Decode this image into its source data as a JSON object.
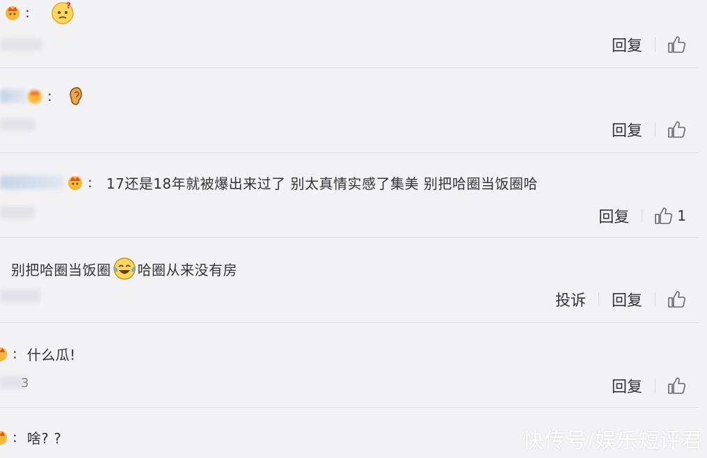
{
  "comments": [
    {
      "text": "",
      "meta": "",
      "actions": {
        "reply": "回复"
      }
    },
    {
      "text": "",
      "meta": "",
      "actions": {
        "reply": "回复"
      }
    },
    {
      "text": "17还是18年就被爆出来过了 别太真情实感了集美 别把哈圈当饭圈哈",
      "meta": "",
      "actions": {
        "reply": "回复"
      },
      "likes": "1"
    },
    {
      "text_a": "别把哈圈当饭圈",
      "text_b": "哈圈从来没有房",
      "meta": "",
      "actions": {
        "report": "投诉",
        "reply": "回复"
      }
    },
    {
      "text": "什么瓜!",
      "meta": "3",
      "actions": {
        "reply": "回复"
      }
    },
    {
      "text": "啥? ?",
      "meta": "",
      "actions": {}
    }
  ],
  "separator": ":",
  "watermark": "快传号/娱乐短评君",
  "icons": {
    "crown": "crown-emoji-icon",
    "confused": "confused-face-icon",
    "ear": "ear-icon",
    "laughing": "laughing-tears-icon",
    "like": "thumbs-up-icon"
  }
}
